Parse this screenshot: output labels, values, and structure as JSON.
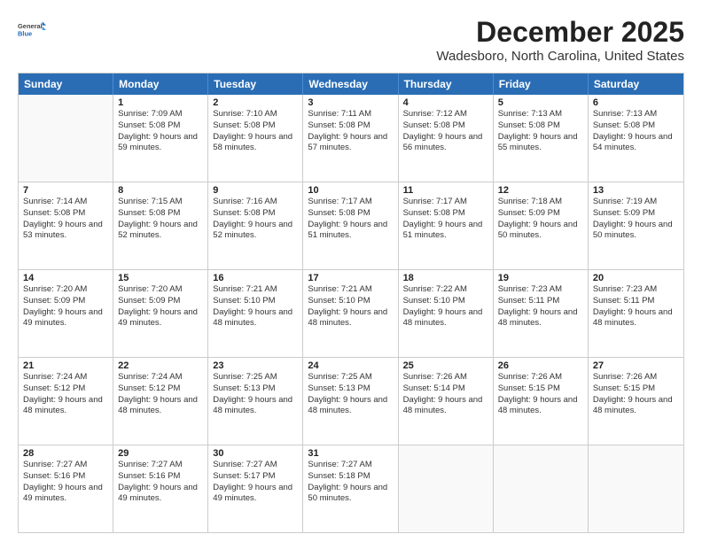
{
  "logo": {
    "general": "General",
    "blue": "Blue"
  },
  "title": "December 2025",
  "subtitle": "Wadesboro, North Carolina, United States",
  "days": [
    "Sunday",
    "Monday",
    "Tuesday",
    "Wednesday",
    "Thursday",
    "Friday",
    "Saturday"
  ],
  "weeks": [
    [
      {
        "day": "",
        "sunrise": "",
        "sunset": "",
        "daylight": ""
      },
      {
        "day": "1",
        "sunrise": "Sunrise: 7:09 AM",
        "sunset": "Sunset: 5:08 PM",
        "daylight": "Daylight: 9 hours and 59 minutes."
      },
      {
        "day": "2",
        "sunrise": "Sunrise: 7:10 AM",
        "sunset": "Sunset: 5:08 PM",
        "daylight": "Daylight: 9 hours and 58 minutes."
      },
      {
        "day": "3",
        "sunrise": "Sunrise: 7:11 AM",
        "sunset": "Sunset: 5:08 PM",
        "daylight": "Daylight: 9 hours and 57 minutes."
      },
      {
        "day": "4",
        "sunrise": "Sunrise: 7:12 AM",
        "sunset": "Sunset: 5:08 PM",
        "daylight": "Daylight: 9 hours and 56 minutes."
      },
      {
        "day": "5",
        "sunrise": "Sunrise: 7:13 AM",
        "sunset": "Sunset: 5:08 PM",
        "daylight": "Daylight: 9 hours and 55 minutes."
      },
      {
        "day": "6",
        "sunrise": "Sunrise: 7:13 AM",
        "sunset": "Sunset: 5:08 PM",
        "daylight": "Daylight: 9 hours and 54 minutes."
      }
    ],
    [
      {
        "day": "7",
        "sunrise": "Sunrise: 7:14 AM",
        "sunset": "Sunset: 5:08 PM",
        "daylight": "Daylight: 9 hours and 53 minutes."
      },
      {
        "day": "8",
        "sunrise": "Sunrise: 7:15 AM",
        "sunset": "Sunset: 5:08 PM",
        "daylight": "Daylight: 9 hours and 52 minutes."
      },
      {
        "day": "9",
        "sunrise": "Sunrise: 7:16 AM",
        "sunset": "Sunset: 5:08 PM",
        "daylight": "Daylight: 9 hours and 52 minutes."
      },
      {
        "day": "10",
        "sunrise": "Sunrise: 7:17 AM",
        "sunset": "Sunset: 5:08 PM",
        "daylight": "Daylight: 9 hours and 51 minutes."
      },
      {
        "day": "11",
        "sunrise": "Sunrise: 7:17 AM",
        "sunset": "Sunset: 5:08 PM",
        "daylight": "Daylight: 9 hours and 51 minutes."
      },
      {
        "day": "12",
        "sunrise": "Sunrise: 7:18 AM",
        "sunset": "Sunset: 5:09 PM",
        "daylight": "Daylight: 9 hours and 50 minutes."
      },
      {
        "day": "13",
        "sunrise": "Sunrise: 7:19 AM",
        "sunset": "Sunset: 5:09 PM",
        "daylight": "Daylight: 9 hours and 50 minutes."
      }
    ],
    [
      {
        "day": "14",
        "sunrise": "Sunrise: 7:20 AM",
        "sunset": "Sunset: 5:09 PM",
        "daylight": "Daylight: 9 hours and 49 minutes."
      },
      {
        "day": "15",
        "sunrise": "Sunrise: 7:20 AM",
        "sunset": "Sunset: 5:09 PM",
        "daylight": "Daylight: 9 hours and 49 minutes."
      },
      {
        "day": "16",
        "sunrise": "Sunrise: 7:21 AM",
        "sunset": "Sunset: 5:10 PM",
        "daylight": "Daylight: 9 hours and 48 minutes."
      },
      {
        "day": "17",
        "sunrise": "Sunrise: 7:21 AM",
        "sunset": "Sunset: 5:10 PM",
        "daylight": "Daylight: 9 hours and 48 minutes."
      },
      {
        "day": "18",
        "sunrise": "Sunrise: 7:22 AM",
        "sunset": "Sunset: 5:10 PM",
        "daylight": "Daylight: 9 hours and 48 minutes."
      },
      {
        "day": "19",
        "sunrise": "Sunrise: 7:23 AM",
        "sunset": "Sunset: 5:11 PM",
        "daylight": "Daylight: 9 hours and 48 minutes."
      },
      {
        "day": "20",
        "sunrise": "Sunrise: 7:23 AM",
        "sunset": "Sunset: 5:11 PM",
        "daylight": "Daylight: 9 hours and 48 minutes."
      }
    ],
    [
      {
        "day": "21",
        "sunrise": "Sunrise: 7:24 AM",
        "sunset": "Sunset: 5:12 PM",
        "daylight": "Daylight: 9 hours and 48 minutes."
      },
      {
        "day": "22",
        "sunrise": "Sunrise: 7:24 AM",
        "sunset": "Sunset: 5:12 PM",
        "daylight": "Daylight: 9 hours and 48 minutes."
      },
      {
        "day": "23",
        "sunrise": "Sunrise: 7:25 AM",
        "sunset": "Sunset: 5:13 PM",
        "daylight": "Daylight: 9 hours and 48 minutes."
      },
      {
        "day": "24",
        "sunrise": "Sunrise: 7:25 AM",
        "sunset": "Sunset: 5:13 PM",
        "daylight": "Daylight: 9 hours and 48 minutes."
      },
      {
        "day": "25",
        "sunrise": "Sunrise: 7:26 AM",
        "sunset": "Sunset: 5:14 PM",
        "daylight": "Daylight: 9 hours and 48 minutes."
      },
      {
        "day": "26",
        "sunrise": "Sunrise: 7:26 AM",
        "sunset": "Sunset: 5:15 PM",
        "daylight": "Daylight: 9 hours and 48 minutes."
      },
      {
        "day": "27",
        "sunrise": "Sunrise: 7:26 AM",
        "sunset": "Sunset: 5:15 PM",
        "daylight": "Daylight: 9 hours and 48 minutes."
      }
    ],
    [
      {
        "day": "28",
        "sunrise": "Sunrise: 7:27 AM",
        "sunset": "Sunset: 5:16 PM",
        "daylight": "Daylight: 9 hours and 49 minutes."
      },
      {
        "day": "29",
        "sunrise": "Sunrise: 7:27 AM",
        "sunset": "Sunset: 5:16 PM",
        "daylight": "Daylight: 9 hours and 49 minutes."
      },
      {
        "day": "30",
        "sunrise": "Sunrise: 7:27 AM",
        "sunset": "Sunset: 5:17 PM",
        "daylight": "Daylight: 9 hours and 49 minutes."
      },
      {
        "day": "31",
        "sunrise": "Sunrise: 7:27 AM",
        "sunset": "Sunset: 5:18 PM",
        "daylight": "Daylight: 9 hours and 50 minutes."
      },
      {
        "day": "",
        "sunrise": "",
        "sunset": "",
        "daylight": ""
      },
      {
        "day": "",
        "sunrise": "",
        "sunset": "",
        "daylight": ""
      },
      {
        "day": "",
        "sunrise": "",
        "sunset": "",
        "daylight": ""
      }
    ]
  ]
}
